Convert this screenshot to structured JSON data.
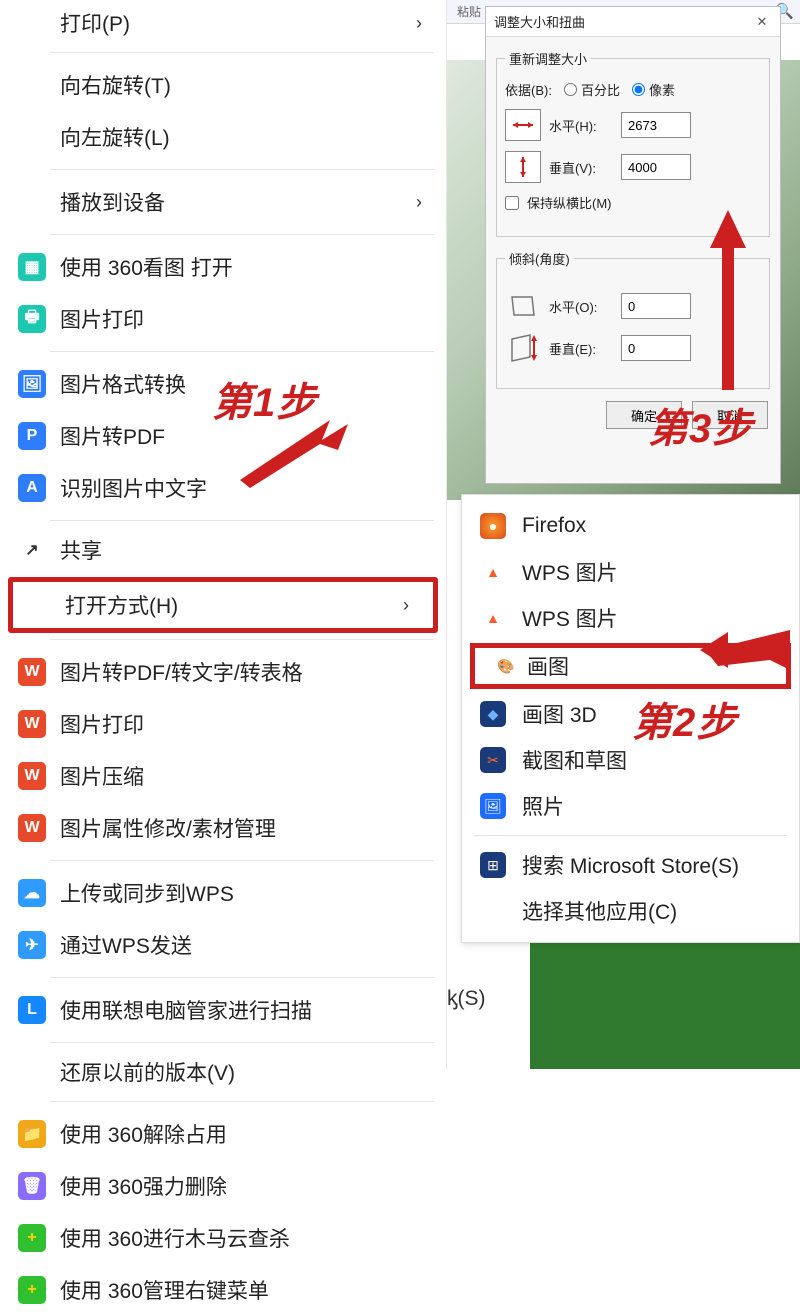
{
  "ctx": {
    "print": "打印(P)",
    "rotate_r": "向右旋转(T)",
    "rotate_l": "向左旋转(L)",
    "cast": "播放到设备",
    "open_360": "使用 360看图 打开",
    "pic_print": "图片打印",
    "pic_convert": "图片格式转换",
    "pic_pdf": "图片转PDF",
    "ocr": "识别图片中文字",
    "share": "共享",
    "open_with": "打开方式(H)",
    "wps_convert": "图片转PDF/转文字/转表格",
    "wps_print": "图片打印",
    "wps_compress": "图片压缩",
    "wps_attr": "图片属性修改/素材管理",
    "wps_up": "上传或同步到WPS",
    "wps_send": "通过WPS发送",
    "lenovo": "使用联想电脑管家进行扫描",
    "restore": "还原以前的版本(V)",
    "u360_release": "使用 360解除占用",
    "u360_del": "使用 360强力删除",
    "u360_scan": "使用 360进行木马云查杀",
    "u360_menu": "使用 360管理右键菜单",
    "arrow": "›"
  },
  "sub": {
    "firefox": "Firefox",
    "wps1": "WPS 图片",
    "wps2": "WPS 图片",
    "paint": "画图",
    "paint3d": "画图 3D",
    "snip": "截图和草图",
    "photos": "照片",
    "store": "搜索 Microsoft Store(S)",
    "choose": "选择其他应用(C)"
  },
  "dlg": {
    "title": "调整大小和扭曲",
    "resize_legend": "重新调整大小",
    "by_label": "依据(B):",
    "percent": "百分比",
    "pixel": "像素",
    "horiz": "水平(H):",
    "vert": "垂直(V):",
    "hval": "2673",
    "vval": "4000",
    "keep": "保持纵横比(M)",
    "skew_legend": "倾斜(角度)",
    "skew_h": "水平(O):",
    "skew_v": "垂直(E):",
    "skew_hv": "0",
    "skew_vv": "0",
    "ok": "确定",
    "cancel": "取消"
  },
  "steps": {
    "s1": "第1步",
    "s2": "第2步",
    "s3": "第3步"
  },
  "misc": {
    "paste": "粘贴",
    "ext": "ᶄ(S)"
  }
}
